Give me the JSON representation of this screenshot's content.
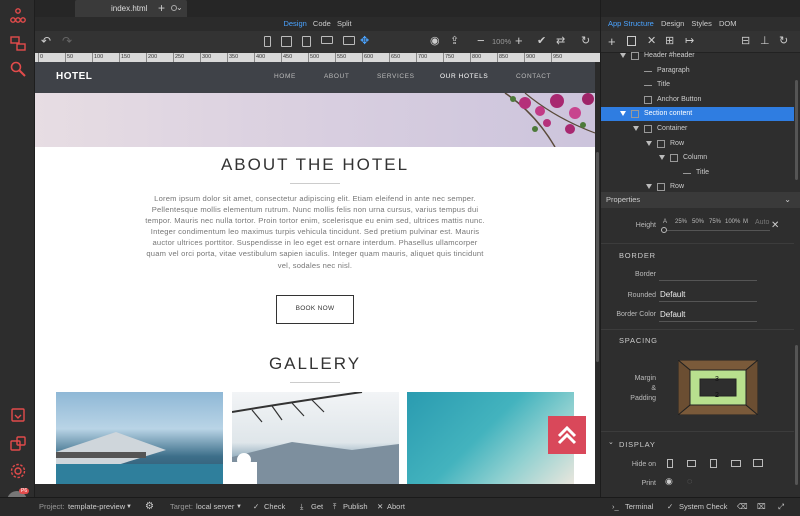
{
  "tab": {
    "filename": "index.html"
  },
  "modes": {
    "design": "Design",
    "code": "Code",
    "split": "Split"
  },
  "toolbar": {
    "zoom": "100%"
  },
  "ruler": [
    "0",
    "50",
    "100",
    "150",
    "200",
    "250",
    "300",
    "350",
    "400",
    "450",
    "500",
    "550",
    "600",
    "650",
    "700",
    "750",
    "800",
    "850",
    "900",
    "950"
  ],
  "site": {
    "brand": "HOTEL",
    "nav": [
      "HOME",
      "ABOUT",
      "SERVICES",
      "OUR HOTELS",
      "CONTACT"
    ],
    "about_title": "ABOUT THE HOTEL",
    "lorem": "Lorem ipsum dolor sit amet, consectetur adipiscing elit. Etiam eleifend in ante nec semper. Pellentesque mollis elementum rutrum. Nunc mollis felis non urna cursus, varius tempus dui tempor. Mauris nec nulla tortor. Proin tortor enim, scelerisque eu enim sed, ultrices mattis nunc. Integer condimentum leo maximus turpis vehicula tincidunt. Sed pretium pulvinar est. Mauris auctor ultrices porttitor. Suspendisse in leo eget est ornare interdum. Phasellus ullamcorper quam vel orci porta, vitae vestibulum sapien iaculis. Integer quam mauris, aliquet quis tincidunt vel, sodales nec nisl.",
    "book_button": "BOOK NOW",
    "gallery_title": "GALLERY"
  },
  "right_panel": {
    "tabs": [
      "App Structure",
      "Design",
      "Styles",
      "DOM"
    ],
    "tree": [
      {
        "label": "Header #header",
        "indent": 1,
        "icon": "header"
      },
      {
        "label": "Paragraph",
        "indent": 2,
        "icon": "text"
      },
      {
        "label": "Title",
        "indent": 2,
        "icon": "title"
      },
      {
        "label": "Anchor Button",
        "indent": 2,
        "icon": "anchor"
      },
      {
        "label": "Section content",
        "indent": 1,
        "icon": "section",
        "selected": true
      },
      {
        "label": "Container",
        "indent": 2,
        "icon": "container"
      },
      {
        "label": "Row",
        "indent": 3,
        "icon": "row"
      },
      {
        "label": "Column",
        "indent": 4,
        "icon": "column"
      },
      {
        "label": "Title",
        "indent": 5,
        "icon": "title"
      },
      {
        "label": "Row",
        "indent": 3,
        "icon": "row"
      }
    ],
    "properties_title": "Properties",
    "height_label": "Height",
    "height_options": [
      "A",
      "25%",
      "50%",
      "75%",
      "100%",
      "M",
      "Auto"
    ],
    "border_section": "BORDER",
    "border_label": "Border",
    "rounded_label": "Rounded",
    "rounded_value": "Default",
    "border_color_label": "Border Color",
    "border_color_value": "Default",
    "spacing_section": "SPACING",
    "margin_label": "Margin",
    "amp_label": "&",
    "padding_label": "Padding",
    "spacing_top": "3",
    "spacing_bottom": "2",
    "display_section": "DISPLAY",
    "hide_on_label": "Hide on",
    "print_label": "Print"
  },
  "status_bar": {
    "project_label": "Project:",
    "project_value": "template-preview",
    "target_label": "Target:",
    "target_value": "local server",
    "check": "Check",
    "get": "Get",
    "publish": "Publish",
    "abort": "Abort",
    "terminal": "Terminal",
    "system_check": "System Check",
    "avatar_badge": "P6"
  },
  "colors": {
    "accent": "#2f7de1",
    "scroll_up": "#d9485a",
    "nav_bg": "#3f4248"
  }
}
